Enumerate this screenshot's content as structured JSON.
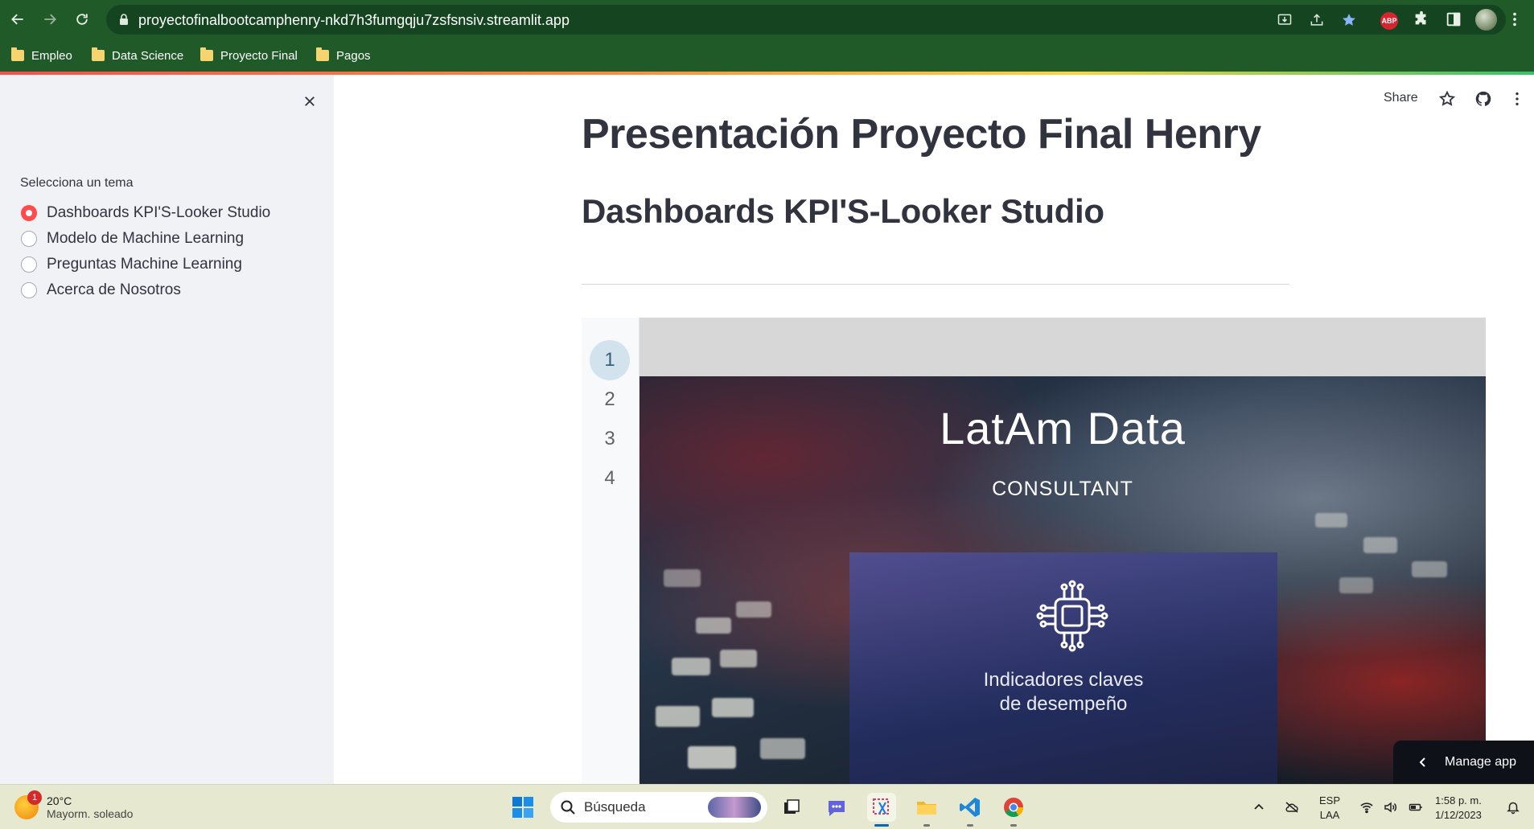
{
  "browser": {
    "url": "proyectofinalbootcamphenry-nkd7h3fumgqju7zsfsnsiv.streamlit.app",
    "abp_label": "ABP",
    "bookmarks": [
      {
        "label": "Empleo"
      },
      {
        "label": "Data Science"
      },
      {
        "label": "Proyecto Final"
      },
      {
        "label": "Pagos"
      }
    ],
    "colors": {
      "frame": "#1f5a28",
      "omnibox": "#154520"
    }
  },
  "sidebar": {
    "radio_label": "Selecciona un tema",
    "options": [
      {
        "label": "Dashboards KPI'S-Looker Studio",
        "selected": true
      },
      {
        "label": "Modelo de Machine Learning",
        "selected": false
      },
      {
        "label": "Preguntas Machine Learning",
        "selected": false
      },
      {
        "label": "Acerca de Nosotros",
        "selected": false
      }
    ]
  },
  "header": {
    "share_label": "Share"
  },
  "main": {
    "title": "Presentación Proyecto Final Henry",
    "subtitle": "Dashboards KPI'S-Looker Studio"
  },
  "viewer": {
    "pages": [
      "1",
      "2",
      "3",
      "4"
    ],
    "current_page": "1",
    "slide": {
      "title": "LatAm Data",
      "subtitle": "CONSULTANT",
      "card_text_line1": "Indicadores claves",
      "card_text_line2": "de desempeño"
    }
  },
  "manage_app": {
    "label": "Manage app"
  },
  "taskbar": {
    "weather_badge": "1",
    "weather_temp": "20°C",
    "weather_desc": "Mayorm. soleado",
    "search_placeholder": "Búsqueda",
    "lang_line1": "ESP",
    "lang_line2": "LAA",
    "time": "1:58 p. m.",
    "date": "1/12/2023"
  },
  "accent_color": "#ff4b4b"
}
